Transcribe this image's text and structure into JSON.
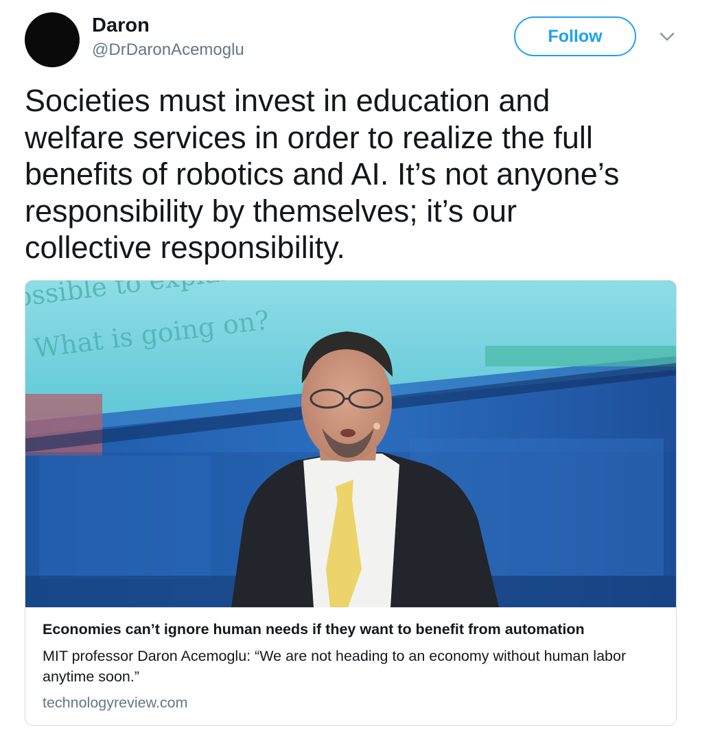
{
  "author": {
    "name": "Daron",
    "handle": "@DrDaronAcemoglu"
  },
  "actions": {
    "follow_label": "Follow",
    "more_icon": "chevron-down-icon"
  },
  "tweet": {
    "lines": [
      "Societies must invest in education and",
      "welfare services in order to realize the full",
      "benefits of robotics and AI. It’s not anyone’s",
      "responsibility by themselves; it’s our",
      "collective responsibility."
    ]
  },
  "card": {
    "slide_text_1": "ossible to explain",
    "slide_text_2": "What is going on?",
    "title": "Economies can’t ignore human needs if they want to benefit from automation",
    "description": "MIT professor Daron Acemoglu: “We are not heading to an economy without human labor anytime soon.”",
    "domain": "technologyreview.com"
  },
  "colors": {
    "accent": "#1da1f2",
    "secondary_text": "#657786",
    "text": "#14171a"
  }
}
